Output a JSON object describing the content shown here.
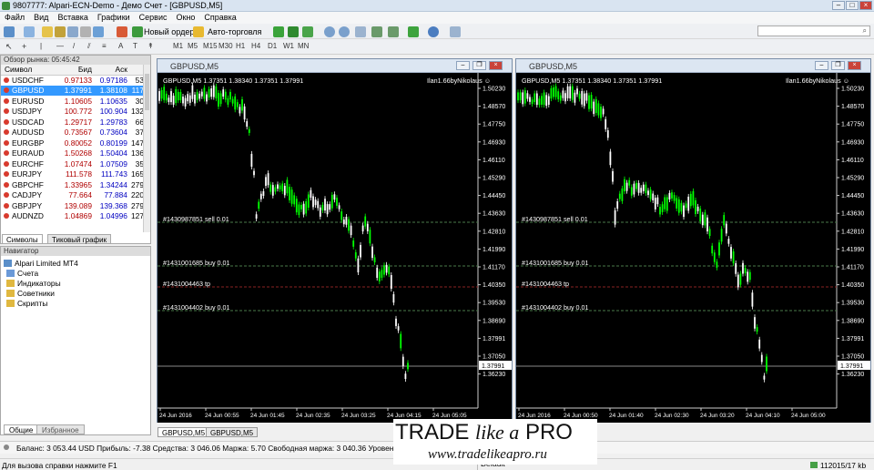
{
  "window": {
    "title": "9807777: Alpari-ECN-Demo - Демо Счет - [GBPUSD,M5]"
  },
  "menu": [
    "Файл",
    "Вид",
    "Вставка",
    "Графики",
    "Сервис",
    "Окно",
    "Справка"
  ],
  "toolbar": {
    "new_order": "Новый ордер",
    "autotrading": "Авто-торговля",
    "timeframes": [
      "M1",
      "M5",
      "M15",
      "M30",
      "H1",
      "H4",
      "D1",
      "W1",
      "MN"
    ]
  },
  "market_watch": {
    "title": "Обзор рынка: 05:45:42",
    "columns": [
      "Символ",
      "Бид",
      "Аск",
      ""
    ],
    "rows": [
      {
        "symbol": "USDCHF",
        "bid": "0.97133",
        "ask": "0.97186",
        "spread": "53"
      },
      {
        "symbol": "GBPUSD",
        "bid": "1.37991",
        "ask": "1.38108",
        "spread": "117",
        "selected": true
      },
      {
        "symbol": "EURUSD",
        "bid": "1.10605",
        "ask": "1.10635",
        "spread": "30"
      },
      {
        "symbol": "USDJPY",
        "bid": "100.772",
        "ask": "100.904",
        "spread": "132"
      },
      {
        "symbol": "USDCAD",
        "bid": "1.29717",
        "ask": "1.29783",
        "spread": "66"
      },
      {
        "symbol": "AUDUSD",
        "bid": "0.73567",
        "ask": "0.73604",
        "spread": "37"
      },
      {
        "symbol": "EURGBP",
        "bid": "0.80052",
        "ask": "0.80199",
        "spread": "147"
      },
      {
        "symbol": "EURAUD",
        "bid": "1.50268",
        "ask": "1.50404",
        "spread": "136"
      },
      {
        "symbol": "EURCHF",
        "bid": "1.07474",
        "ask": "1.07509",
        "spread": "35"
      },
      {
        "symbol": "EURJPY",
        "bid": "111.578",
        "ask": "111.743",
        "spread": "165"
      },
      {
        "symbol": "GBPCHF",
        "bid": "1.33965",
        "ask": "1.34244",
        "spread": "279"
      },
      {
        "symbol": "CADJPY",
        "bid": "77.664",
        "ask": "77.884",
        "spread": "220"
      },
      {
        "symbol": "GBPJPY",
        "bid": "139.089",
        "ask": "139.368",
        "spread": "279"
      },
      {
        "symbol": "AUDNZD",
        "bid": "1.04869",
        "ask": "1.04996",
        "spread": "127"
      }
    ],
    "tabs": [
      "Символы",
      "Тиковый график"
    ]
  },
  "navigator": {
    "title": "Навигатор",
    "root": "Alpari Limited MT4",
    "items": [
      "Счета",
      "Индикаторы",
      "Советники",
      "Скрипты"
    ],
    "tabs": [
      "Общие",
      "Избранное"
    ]
  },
  "charts": [
    {
      "title": "GBPUSD,M5",
      "header": "GBPUSD,M5  1.37351 1.38340 1.37351 1.37991",
      "ea": "Ilan1.66byNikolaus ☺",
      "times": [
        "24 Jun 2016",
        "24 Jun 00:55",
        "24 Jun 01:45",
        "24 Jun 02:35",
        "24 Jun 03:25",
        "24 Jun 04:15",
        "24 Jun 05:05"
      ],
      "orders": [
        "#1430987851 sell 0.01",
        "#1431001685 buy 0.01",
        "#1431004463 tp",
        "#1431004402 buy 0.01"
      ]
    },
    {
      "title": "GBPUSD,M5",
      "header": "GBPUSD,M5  1.37351 1.38340 1.37351 1.37991",
      "ea": "Ilan1.66byNikolaus ☺",
      "times": [
        "24 Jun 2016",
        "24 Jun 00:50",
        "24 Jun 01:40",
        "24 Jun 02:30",
        "24 Jun 03:20",
        "24 Jun 04:10",
        "24 Jun 05:00"
      ],
      "orders": [
        "#1430987851 sell 0.01",
        "#1431001685 buy 0.01",
        "#1431004463 tp",
        "#1431004402 buy 0.01"
      ]
    }
  ],
  "price_scale": [
    "1.50230",
    "1.48570",
    "1.47750",
    "1.46930",
    "1.46110",
    "1.45290",
    "1.44450",
    "1.43630",
    "1.42810",
    "1.41990",
    "1.41170",
    "1.40350",
    "1.39530",
    "1.38690",
    "1.37991",
    "1.37050",
    "1.36230"
  ],
  "last_price": "1.37991",
  "chart_tabs": [
    "GBPUSD,M5",
    "GBPUSD,M5"
  ],
  "terminal": {
    "text": "Баланс: 3 053.44 USD  Прибыль: -7.38  Средства: 3 046.06  Маржа: 5.70  Свободная маржа: 3 040.36  Уровень: 53439.65%"
  },
  "statusbar": {
    "help": "Для вызова справки нажмите F1",
    "profile": "Default",
    "traffic": "112015/17 kb"
  },
  "watermark": {
    "brand_a": "TRADE",
    "brand_b": "like a",
    "brand_c": "PRO",
    "url": "www.tradelikeapro.ru"
  },
  "colors": {
    "bull": "#00ff00",
    "bear": "#ffffff",
    "selected_row": "#3399ff",
    "order_line": "#4a7a4a",
    "tp_line": "#8a2222"
  }
}
